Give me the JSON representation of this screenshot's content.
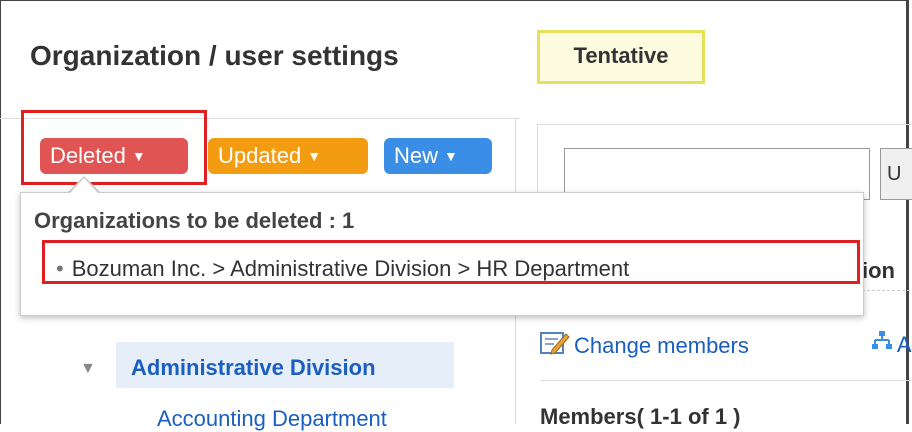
{
  "header": {
    "title": "Organization / user settings",
    "status_label": "Tentative"
  },
  "filters": {
    "deleted_label": "Deleted",
    "updated_label": "Updated",
    "new_label": "New"
  },
  "popup": {
    "heading": "Organizations to be deleted : 1",
    "items": [
      "Bozuman Inc. > Administrative Division > HR Department"
    ]
  },
  "search": {
    "value": "",
    "button_label": "U"
  },
  "right": {
    "clipped_heading": "ion",
    "change_members_label": "Change members",
    "add_label": "A",
    "members_label": "Members( 1-1 of 1 )"
  },
  "tree": {
    "selected_org": "Administrative Division",
    "child_org": "Accounting Department"
  },
  "colors": {
    "deleted": "#e05454",
    "updated": "#f39c12",
    "new": "#3a8ee6",
    "highlight": "#e02020",
    "link": "#1a5fbf"
  }
}
